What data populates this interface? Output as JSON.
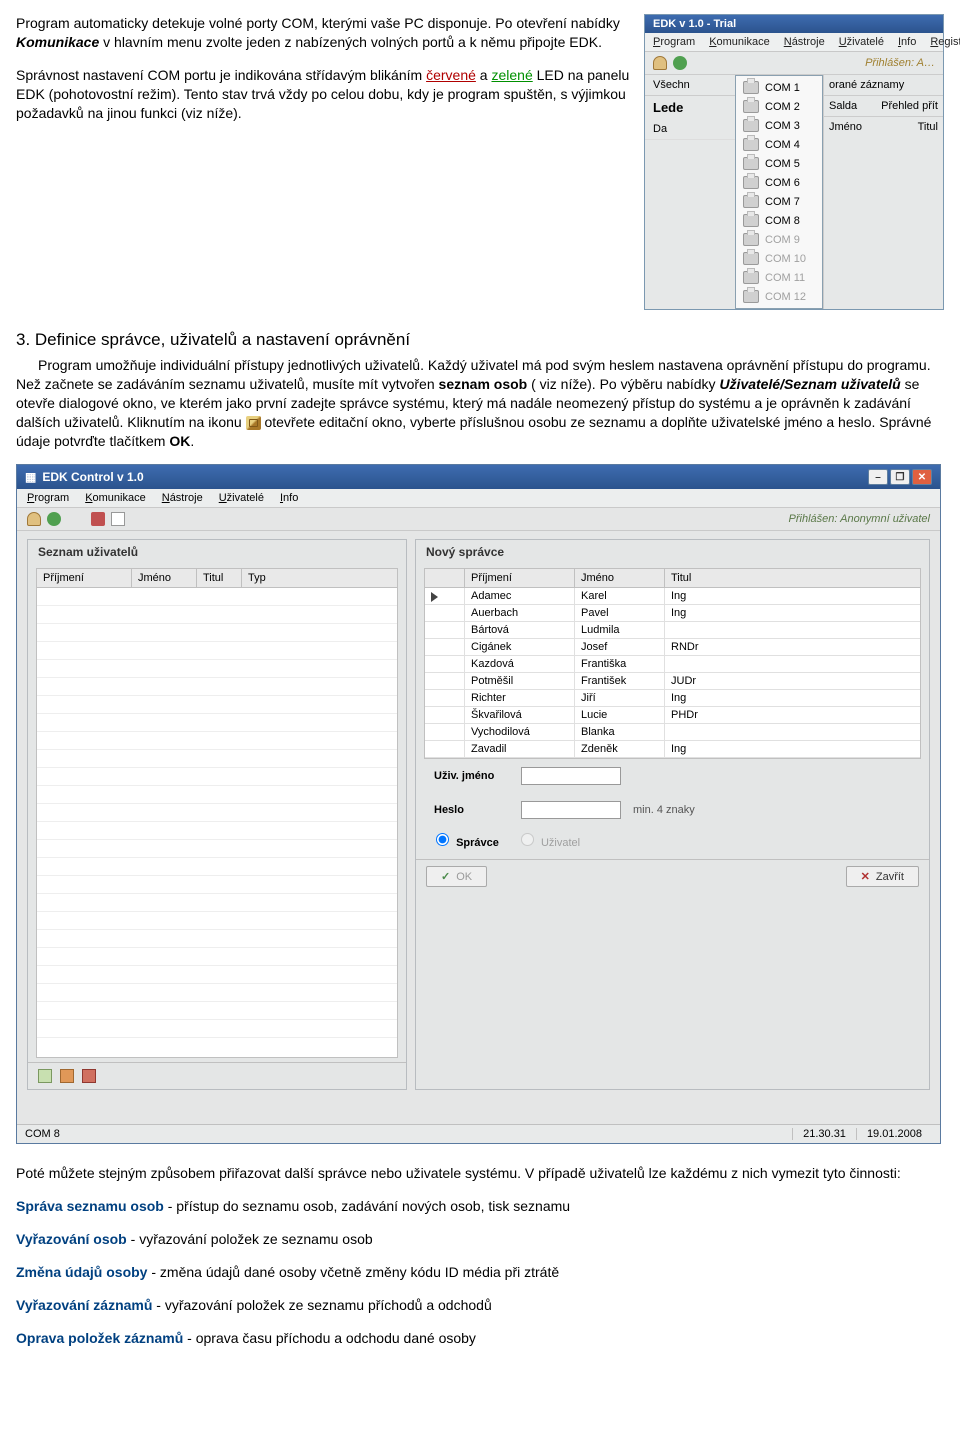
{
  "topText": {
    "p1a": "Program automaticky detekuje volné porty COM, kterými vaše PC disponuje. Po otevření nabídky ",
    "p1b": "Komunikace",
    "p1c": " v hlavním menu zvolte jeden z nabízených volných portů a k němu připojte  EDK.",
    "p2a": "Správnost nastavení COM portu je indikována střídavým blikáním ",
    "p2red": "červené",
    "p2b": " a ",
    "p2green": "zelené",
    "p2c": " LED na panelu EDK (pohotovostní režim). Tento stav trvá vždy po celou dobu, kdy je program spuštěn, s výjimkou požadavků na jinou funkci (viz níže)."
  },
  "comShot": {
    "title": "EDK v 1.0 - Trial",
    "menus": [
      "Program",
      "Komunikace",
      "Nástroje",
      "Uživatelé",
      "Info",
      "Registrace"
    ],
    "prihlasen": "Přihlášen: A…",
    "left": {
      "vsech": "Všechn",
      "lede": "Lede",
      "da": "Da"
    },
    "right": {
      "rane": "orané záznamy",
      "salda": "Salda",
      "prehled": "Přehled přít",
      "jmeno": "Jméno",
      "titul": "Titul"
    },
    "coms": [
      "COM 1",
      "COM 2",
      "COM 3",
      "COM 4",
      "COM 5",
      "COM 6",
      "COM 7",
      "COM 8",
      "COM 9",
      "COM 10",
      "COM 11",
      "COM 12"
    ],
    "enabled": [
      0,
      1,
      2,
      3,
      4,
      5,
      6,
      7
    ]
  },
  "sec3": {
    "title": "3. Definice správce, uživatelů a nastavení oprávnění",
    "p1": "Program umožňuje individuální přístupy jednotlivých uživatelů. Každý uživatel má pod svým heslem nastavena oprávnění přístupu do programu. Než začnete se zadáváním seznamu uživatelů, musíte mít vytvořen ",
    "p1b": "seznam osob",
    "p1c": " ( viz níže). Po výběru nabídky ",
    "p1i": "Uživatelé/Seznam uživatelů",
    "p1d": " se otevře dialogové okno, ve kterém jako první zadejte správce systému, který má nadále neomezený přístup do systému a je oprávněn k zadávání dalších uživatelů. Kliknutím na ikonu ",
    "p1e": " otevřete editační okno, vyberte příslušnou osobu ze seznamu a doplňte uživatelské jméno a heslo. Správné údaje potvrďte tlačítkem ",
    "ok": "OK",
    "dot": "."
  },
  "lgShot": {
    "title": "EDK Control v 1.0",
    "menus": [
      "Program",
      "Komunikace",
      "Nástroje",
      "Uživatelé",
      "Info"
    ],
    "logged": "Přihlášen: Anonymní uživatel",
    "leftPanel": {
      "title": "Seznam uživatelů",
      "headers": [
        "Příjmení",
        "Jméno",
        "Titul",
        "Typ"
      ]
    },
    "rightPanel": {
      "title": "Nový správce",
      "headers": [
        "",
        "Příjmení",
        "Jméno",
        "Titul"
      ],
      "rows": [
        [
          "Adamec",
          "Karel",
          "Ing"
        ],
        [
          "Auerbach",
          "Pavel",
          "Ing"
        ],
        [
          "Bártová",
          "Ludmila",
          ""
        ],
        [
          "Cigánek",
          "Josef",
          "RNDr"
        ],
        [
          "Kazdová",
          "Františka",
          ""
        ],
        [
          "Potměšil",
          "František",
          "JUDr"
        ],
        [
          "Richter",
          "Jiří",
          "Ing"
        ],
        [
          "Škvařilová",
          "Lucie",
          "PHDr"
        ],
        [
          "Vychodilová",
          "Blanka",
          ""
        ],
        [
          "Zavadil",
          "Zdeněk",
          "Ing"
        ]
      ],
      "uzivLabel": "Uživ. jméno",
      "hesloLabel": "Heslo",
      "hesloHint": "min. 4 znaky",
      "roleSpravce": "Správce",
      "roleUzivatel": "Uživatel",
      "okBtn": "OK",
      "zavritBtn": "Zavřít"
    },
    "status": {
      "com": "COM 8",
      "time": "21.30.31",
      "date": "19.01.2008"
    }
  },
  "after": {
    "p": "Poté můžete stejným způsobem přiřazovat další správce nebo uživatele systému. V případě uživatelů lze každému z nich vymezit tyto činnosti:",
    "items": [
      {
        "b": "Správa seznamu osob",
        "t": "  - přístup do seznamu osob, zadávání nových osob, tisk seznamu"
      },
      {
        "b": "Vyřazování osob",
        "t": "  - vyřazování položek ze seznamu osob"
      },
      {
        "b": "Změna údajů osoby",
        "t": "  - změna údajů dané osoby včetně změny kódu ID média při ztrátě"
      },
      {
        "b": "Vyřazování záznamů",
        "t": "  - vyřazování položek ze seznamu příchodů a odchodů"
      },
      {
        "b": "Oprava položek záznamů",
        "t": "  - oprava času příchodu a odchodu dané osoby"
      }
    ]
  }
}
